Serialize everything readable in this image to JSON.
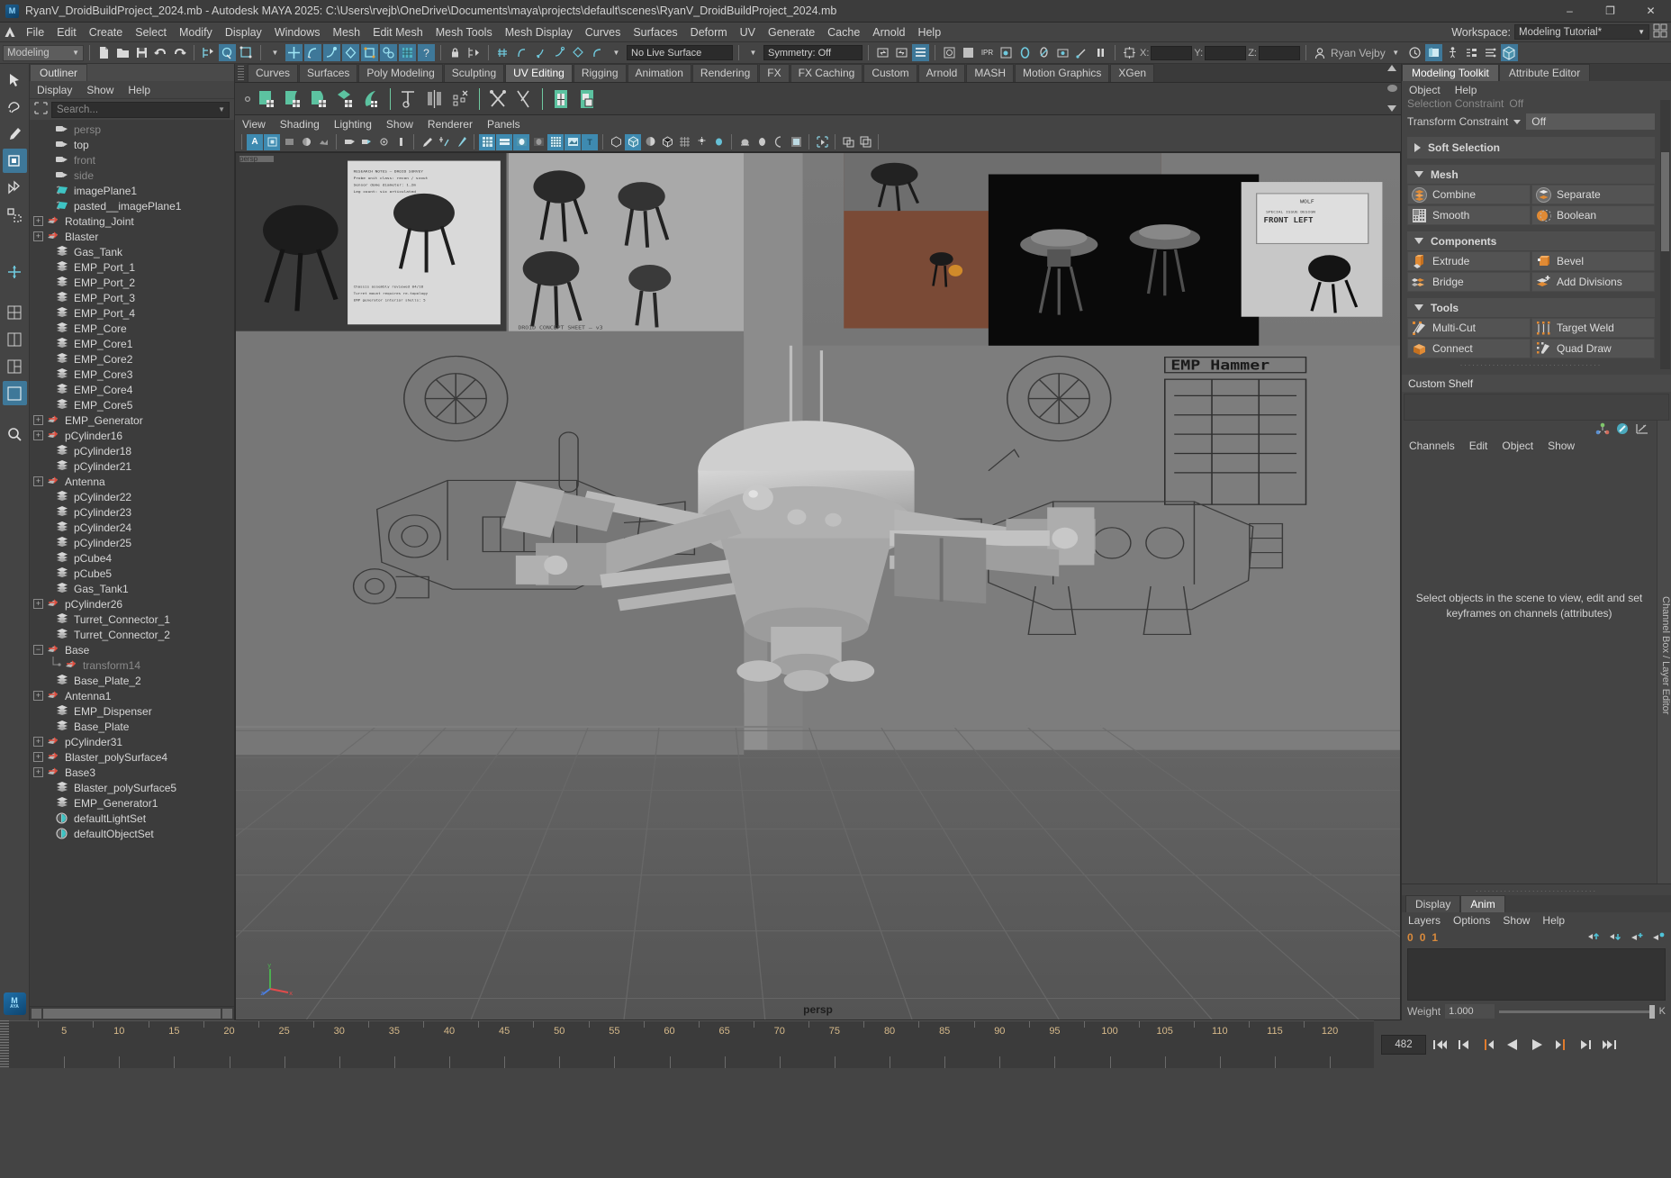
{
  "titlebar": {
    "title": "RyanV_DroidBuildProject_2024.mb - Autodesk MAYA 2025: C:\\Users\\rvejb\\OneDrive\\Documents\\maya\\projects\\default\\scenes\\RyanV_DroidBuildProject_2024.mb",
    "minimize": "–",
    "maximize": "❐",
    "close": "✕"
  },
  "menubar": {
    "items": [
      "File",
      "Edit",
      "Create",
      "Select",
      "Modify",
      "Display",
      "Windows",
      "Mesh",
      "Edit Mesh",
      "Mesh Tools",
      "Mesh Display",
      "Curves",
      "Surfaces",
      "Deform",
      "UV",
      "Generate",
      "Cache",
      "Arnold",
      "Help"
    ],
    "workspace_label": "Workspace:",
    "workspace_value": "Modeling Tutorial*"
  },
  "statusline": {
    "menuset": "Modeling",
    "live_surface": "No Live Surface",
    "symmetry": "Symmetry: Off",
    "coord_x": "X:",
    "coord_y": "Y:",
    "coord_z": "Z:",
    "coord_x_val": "",
    "coord_y_val": "",
    "coord_z_val": "",
    "user": "Ryan Vejby"
  },
  "outliner": {
    "tab": "Outliner",
    "menus": [
      "Display",
      "Show",
      "Help"
    ],
    "search_placeholder": "Search...",
    "items": [
      {
        "label": "persp",
        "icon": "camera-icon",
        "indent": 1,
        "expand": "none",
        "dim": true
      },
      {
        "label": "top",
        "icon": "camera-icon",
        "indent": 1,
        "expand": "none",
        "dim": false
      },
      {
        "label": "front",
        "icon": "camera-icon",
        "indent": 1,
        "expand": "none",
        "dim": true
      },
      {
        "label": "side",
        "icon": "camera-icon",
        "indent": 1,
        "expand": "none",
        "dim": true
      },
      {
        "label": "imagePlane1",
        "icon": "image-plane-icon",
        "indent": 1,
        "expand": "none",
        "dim": false
      },
      {
        "label": "pasted__imagePlane1",
        "icon": "image-plane-icon",
        "indent": 1,
        "expand": "none",
        "dim": false
      },
      {
        "label": "Rotating_Joint",
        "icon": "joint-icon",
        "indent": 0,
        "expand": "plus",
        "dim": false
      },
      {
        "label": "Blaster",
        "icon": "joint-icon",
        "indent": 0,
        "expand": "plus",
        "dim": false
      },
      {
        "label": "Gas_Tank",
        "icon": "mesh-icon",
        "indent": 1,
        "expand": "none",
        "dim": false
      },
      {
        "label": "EMP_Port_1",
        "icon": "mesh-icon",
        "indent": 1,
        "expand": "none",
        "dim": false
      },
      {
        "label": "EMP_Port_2",
        "icon": "mesh-icon",
        "indent": 1,
        "expand": "none",
        "dim": false
      },
      {
        "label": "EMP_Port_3",
        "icon": "mesh-icon",
        "indent": 1,
        "expand": "none",
        "dim": false
      },
      {
        "label": "EMP_Port_4",
        "icon": "mesh-icon",
        "indent": 1,
        "expand": "none",
        "dim": false
      },
      {
        "label": "EMP_Core",
        "icon": "mesh-icon",
        "indent": 1,
        "expand": "none",
        "dim": false
      },
      {
        "label": "EMP_Core1",
        "icon": "mesh-icon",
        "indent": 1,
        "expand": "none",
        "dim": false
      },
      {
        "label": "EMP_Core2",
        "icon": "mesh-icon",
        "indent": 1,
        "expand": "none",
        "dim": false
      },
      {
        "label": "EMP_Core3",
        "icon": "mesh-icon",
        "indent": 1,
        "expand": "none",
        "dim": false
      },
      {
        "label": "EMP_Core4",
        "icon": "mesh-icon",
        "indent": 1,
        "expand": "none",
        "dim": false
      },
      {
        "label": "EMP_Core5",
        "icon": "mesh-icon",
        "indent": 1,
        "expand": "none",
        "dim": false
      },
      {
        "label": "EMP_Generator",
        "icon": "joint-icon",
        "indent": 0,
        "expand": "plus",
        "dim": false
      },
      {
        "label": "pCylinder16",
        "icon": "joint-icon",
        "indent": 0,
        "expand": "plus",
        "dim": false
      },
      {
        "label": "pCylinder18",
        "icon": "mesh-icon",
        "indent": 1,
        "expand": "none",
        "dim": false
      },
      {
        "label": "pCylinder21",
        "icon": "mesh-icon",
        "indent": 1,
        "expand": "none",
        "dim": false
      },
      {
        "label": "Antenna",
        "icon": "joint-icon",
        "indent": 0,
        "expand": "plus",
        "dim": false
      },
      {
        "label": "pCylinder22",
        "icon": "mesh-icon",
        "indent": 1,
        "expand": "none",
        "dim": false
      },
      {
        "label": "pCylinder23",
        "icon": "mesh-icon",
        "indent": 1,
        "expand": "none",
        "dim": false
      },
      {
        "label": "pCylinder24",
        "icon": "mesh-icon",
        "indent": 1,
        "expand": "none",
        "dim": false
      },
      {
        "label": "pCylinder25",
        "icon": "mesh-icon",
        "indent": 1,
        "expand": "none",
        "dim": false
      },
      {
        "label": "pCube4",
        "icon": "mesh-icon",
        "indent": 1,
        "expand": "none",
        "dim": false
      },
      {
        "label": "pCube5",
        "icon": "mesh-icon",
        "indent": 1,
        "expand": "none",
        "dim": false
      },
      {
        "label": "Gas_Tank1",
        "icon": "mesh-icon",
        "indent": 1,
        "expand": "none",
        "dim": false
      },
      {
        "label": "pCylinder26",
        "icon": "joint-icon",
        "indent": 0,
        "expand": "plus",
        "dim": false
      },
      {
        "label": "Turret_Connector_1",
        "icon": "mesh-icon",
        "indent": 1,
        "expand": "none",
        "dim": false
      },
      {
        "label": "Turret_Connector_2",
        "icon": "mesh-icon",
        "indent": 1,
        "expand": "none",
        "dim": false
      },
      {
        "label": "Base",
        "icon": "joint-icon",
        "indent": 0,
        "expand": "minus",
        "dim": false
      },
      {
        "label": "transform14",
        "icon": "joint-icon",
        "indent": 2,
        "expand": "none",
        "dim": true,
        "tree": true
      },
      {
        "label": "Base_Plate_2",
        "icon": "mesh-icon",
        "indent": 1,
        "expand": "none",
        "dim": false
      },
      {
        "label": "Antenna1",
        "icon": "joint-icon",
        "indent": 0,
        "expand": "plus",
        "dim": false
      },
      {
        "label": "EMP_Dispenser",
        "icon": "mesh-icon",
        "indent": 1,
        "expand": "none",
        "dim": false
      },
      {
        "label": "Base_Plate",
        "icon": "mesh-icon",
        "indent": 1,
        "expand": "none",
        "dim": false
      },
      {
        "label": "pCylinder31",
        "icon": "joint-icon",
        "indent": 0,
        "expand": "plus",
        "dim": false
      },
      {
        "label": "Blaster_polySurface4",
        "icon": "joint-icon",
        "indent": 0,
        "expand": "plus",
        "dim": false
      },
      {
        "label": "Base3",
        "icon": "joint-icon",
        "indent": 0,
        "expand": "plus",
        "dim": false
      },
      {
        "label": "Blaster_polySurface5",
        "icon": "mesh-icon",
        "indent": 1,
        "expand": "none",
        "dim": false
      },
      {
        "label": "EMP_Generator1",
        "icon": "mesh-icon",
        "indent": 1,
        "expand": "none",
        "dim": false
      },
      {
        "label": "defaultLightSet",
        "icon": "set-icon",
        "indent": 1,
        "expand": "none",
        "dim": false
      },
      {
        "label": "defaultObjectSet",
        "icon": "set-icon",
        "indent": 1,
        "expand": "none",
        "dim": false
      }
    ]
  },
  "shelf": {
    "tabs": [
      "Curves",
      "Surfaces",
      "Poly Modeling",
      "Sculpting",
      "UV Editing",
      "Rigging",
      "Animation",
      "Rendering",
      "FX",
      "FX Caching",
      "Custom",
      "Arnold",
      "MASH",
      "Motion Graphics",
      "XGen"
    ],
    "active_tab": "UV Editing"
  },
  "viewport": {
    "menus": [
      "View",
      "Shading",
      "Lighting",
      "Show",
      "Renderer",
      "Panels"
    ],
    "camera_label": "persp",
    "hud_text": "persp"
  },
  "modeling_toolkit": {
    "tabs": [
      "Modeling Toolkit",
      "Attribute Editor"
    ],
    "active_tab": "Modeling Toolkit",
    "menus": [
      "Object",
      "Help"
    ],
    "selection_constraint_label": "Selection Constraint",
    "selection_constraint_value": "Off",
    "transform_constraint_label": "Transform Constraint",
    "transform_constraint_value": "Off",
    "soft_selection_label": "Soft Selection",
    "sections": [
      {
        "title": "Mesh",
        "buttons": [
          {
            "label": "Combine",
            "icon": "combine-icon"
          },
          {
            "label": "Separate",
            "icon": "separate-icon"
          },
          {
            "label": "Smooth",
            "icon": "smooth-icon"
          },
          {
            "label": "Boolean",
            "icon": "boolean-icon"
          }
        ]
      },
      {
        "title": "Components",
        "buttons": [
          {
            "label": "Extrude",
            "icon": "extrude-icon"
          },
          {
            "label": "Bevel",
            "icon": "bevel-icon"
          },
          {
            "label": "Bridge",
            "icon": "bridge-icon"
          },
          {
            "label": "Add Divisions",
            "icon": "add-divisions-icon"
          }
        ]
      },
      {
        "title": "Tools",
        "buttons": [
          {
            "label": "Multi-Cut",
            "icon": "multi-cut-icon"
          },
          {
            "label": "Target Weld",
            "icon": "target-weld-icon"
          },
          {
            "label": "Connect",
            "icon": "connect-icon"
          },
          {
            "label": "Quad Draw",
            "icon": "quad-draw-icon"
          }
        ]
      }
    ],
    "custom_shelf_title": "Custom Shelf"
  },
  "channel_box": {
    "menus": [
      "Channels",
      "Edit",
      "Object",
      "Show"
    ],
    "empty_message_line1": "Select objects in the scene to view, edit and set",
    "empty_message_line2": "keyframes on channels (attributes)",
    "vertical_tab": "Channel Box / Layer Editor"
  },
  "layer_editor": {
    "tabs": [
      "Display",
      "Anim"
    ],
    "active_tab": "Anim",
    "menus": [
      "Layers",
      "Options",
      "Show",
      "Help"
    ],
    "counters": [
      "0",
      "0",
      "1"
    ],
    "weight_label": "Weight",
    "weight_value": "1.000",
    "key_label": "K"
  },
  "timeline": {
    "ticks": [
      5,
      10,
      15,
      20,
      25,
      30,
      35,
      40,
      45,
      50,
      55,
      60,
      65,
      70,
      75,
      80,
      85,
      90,
      95,
      100,
      105,
      110,
      115,
      120
    ],
    "current_frame": "482",
    "playback_buttons": [
      "go-to-start",
      "step-back-key",
      "step-back-frame",
      "play-backwards",
      "play-forwards",
      "step-forward-frame",
      "step-forward-key",
      "go-to-end"
    ]
  }
}
